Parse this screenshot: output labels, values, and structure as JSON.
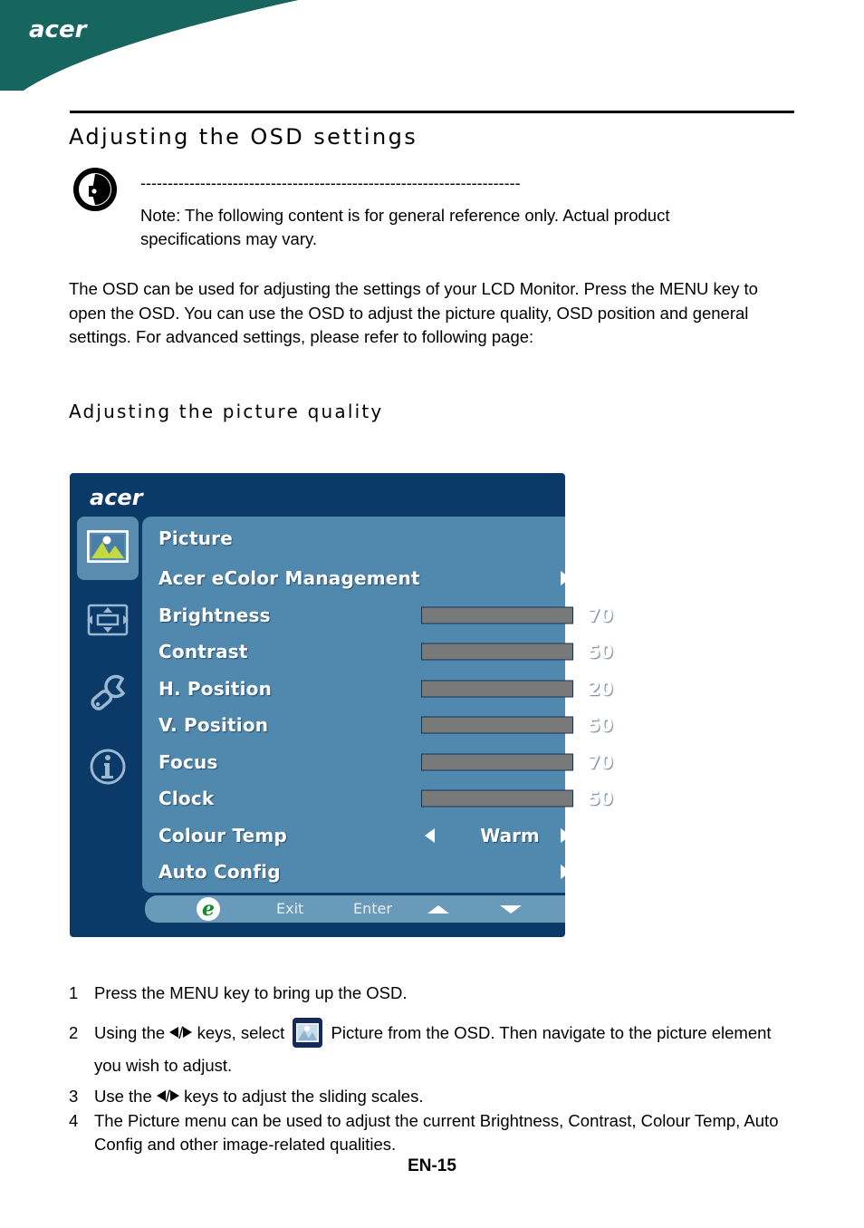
{
  "brand": {
    "logo_text": "acer",
    "header_color": "#16655f"
  },
  "page": {
    "section_heading": "Adjusting  the  OSD  settings",
    "sub_heading": "Adjusting  the  picture  quality",
    "note_rule": "----------------------------------------------------------------------",
    "note_text": "Note: The following content is for general reference only. Actual product specifications may vary.",
    "body_paragraph": "The OSD can be used for adjusting the settings of your LCD Monitor. Press the MENU key to open the OSD. You can use the OSD to adjust the picture quality, OSD position and general settings. For advanced settings, please refer to following page:",
    "footer": "EN-15"
  },
  "osd": {
    "title_logo": "acer",
    "colors": {
      "panel_bg": "#0b3a68",
      "content_bg": "#5188ad",
      "active_icon_bg": "#5a8cb0",
      "bar_track": "#79797a",
      "bar_fill": "#a9d0f0",
      "footer_bg": "#6a9ab9",
      "e_green": "#0f8a2e"
    },
    "sidebar": [
      {
        "name": "picture-icon",
        "active": true
      },
      {
        "name": "osd-position-icon",
        "active": false
      },
      {
        "name": "setting-wrench-icon",
        "active": false
      },
      {
        "name": "information-icon",
        "active": false
      }
    ],
    "menu_title": "Picture",
    "rows": [
      {
        "label": "Acer eColor Management",
        "type": "submenu"
      },
      {
        "label": "Brightness",
        "type": "slider",
        "value": 70
      },
      {
        "label": "Contrast",
        "type": "slider",
        "value": 50
      },
      {
        "label": "H. Position",
        "type": "slider",
        "value": 20
      },
      {
        "label": "V. Position",
        "type": "slider",
        "value": 50
      },
      {
        "label": "Focus",
        "type": "slider",
        "value": 70
      },
      {
        "label": "Clock",
        "type": "slider",
        "value": 50
      },
      {
        "label": "Colour Temp",
        "type": "option",
        "value": "Warm"
      },
      {
        "label": "Auto Config",
        "type": "submenu"
      }
    ],
    "footer": {
      "logo": "e",
      "exit": "Exit",
      "enter": "Enter",
      "up": "up-arrow",
      "down": "down-arrow"
    }
  },
  "steps": [
    {
      "num": "1",
      "text": "Press the MENU key to bring up the OSD."
    },
    {
      "num": "2",
      "text_a": "Using the ",
      "text_b": " keys, select ",
      "text_c": " Picture from the OSD. Then navigate to the picture element you wish to adjust."
    },
    {
      "num": "3",
      "text_a": "Use the ",
      "text_b": " keys to adjust the sliding scales."
    },
    {
      "num": "4",
      "text": "The Picture menu can be used to adjust the current Brightness, Contrast, Colour Temp, Auto Config and other image-related qualities."
    }
  ],
  "glyphs": {
    "slash": "/"
  }
}
